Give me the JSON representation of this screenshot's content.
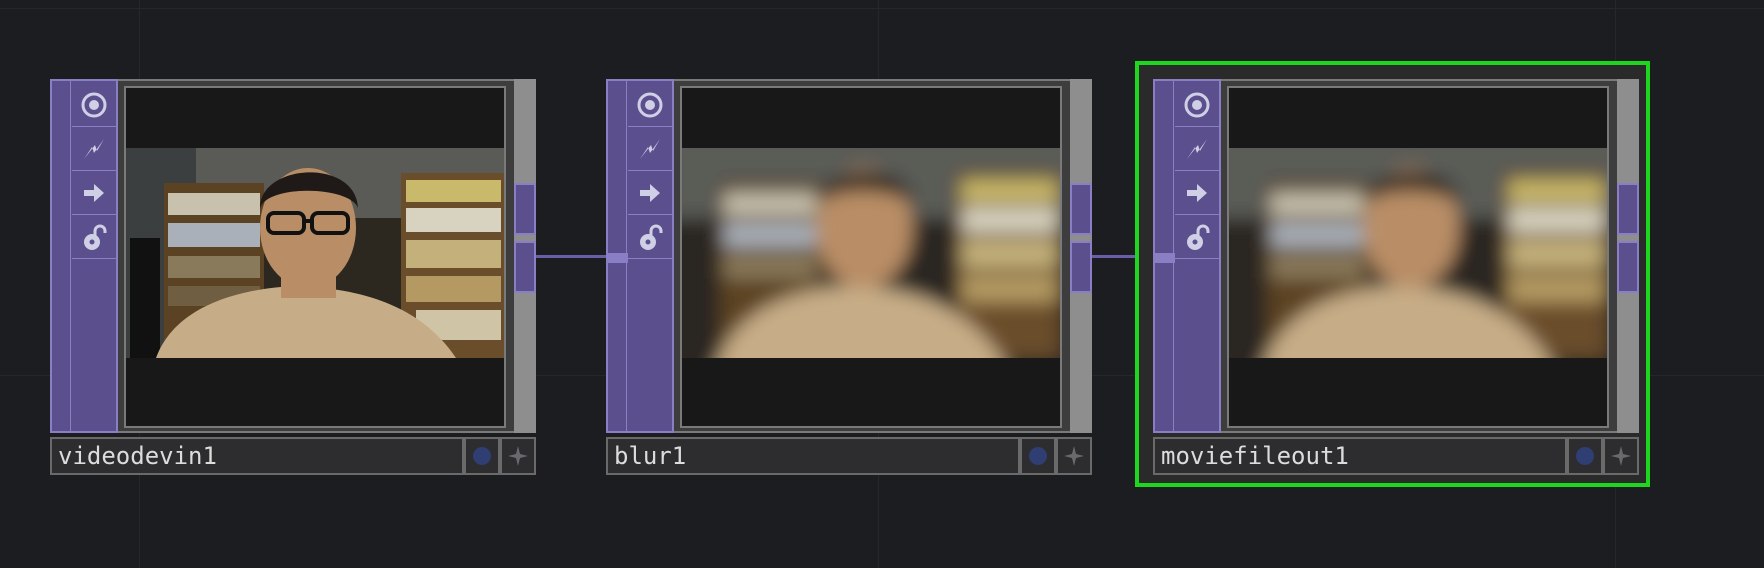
{
  "network": {
    "nodes": [
      {
        "name": "videodevin1",
        "image": "webcam-sharp",
        "selected": false
      },
      {
        "name": "blur1",
        "image": "webcam-blurred",
        "selected": false
      },
      {
        "name": "moviefileout1",
        "image": "webcam-blurred",
        "selected": true
      }
    ],
    "flag_icons": [
      "viewer-toggle-icon",
      "cook-flag-icon",
      "export-flag-icon",
      "lock-icon"
    ],
    "colors": {
      "operator_family": "#5b4f8e",
      "selection": "#1fd61f",
      "wire": "#6b5ea8",
      "background": "#1c1d20"
    }
  }
}
